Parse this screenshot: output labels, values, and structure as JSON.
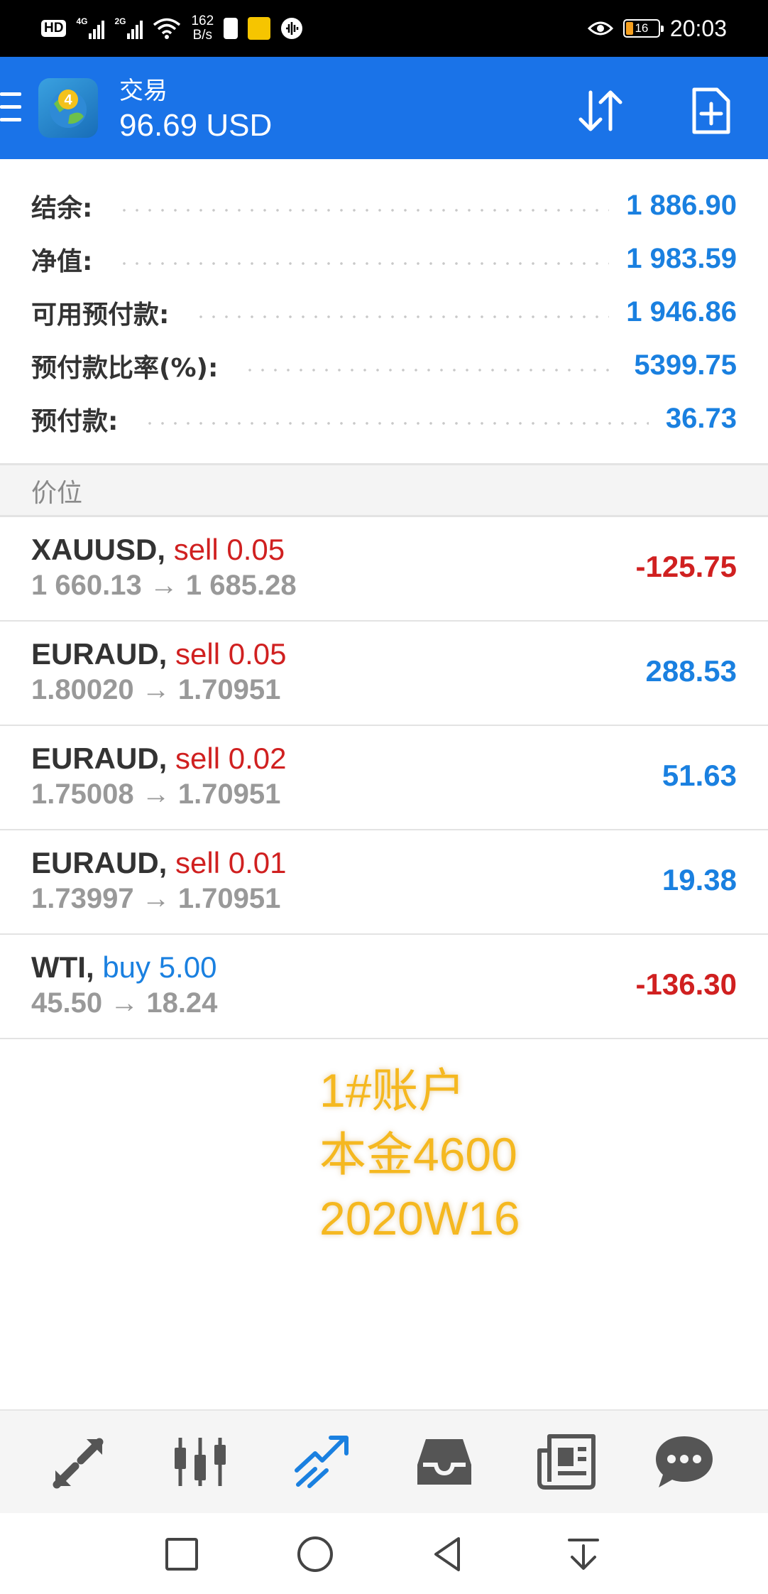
{
  "status_bar": {
    "hd": "HD",
    "net1": "4G",
    "net2": "2G",
    "speed_value": "162",
    "speed_unit": "B/s",
    "battery": "16",
    "time": "20:03"
  },
  "header": {
    "title": "交易",
    "balance": "96.69 USD"
  },
  "summary": [
    {
      "label": "结余:",
      "value": "1 886.90"
    },
    {
      "label": "净值:",
      "value": "1 983.59"
    },
    {
      "label": "可用预付款:",
      "value": "1 946.86"
    },
    {
      "label": "预付款比率(%):",
      "value": "5399.75"
    },
    {
      "label": "预付款:",
      "value": "36.73"
    }
  ],
  "positions_header": "价位",
  "positions": [
    {
      "symbol": "XAUUSD,",
      "side": "sell 0.05",
      "prices": "1 660.13 → 1 685.28",
      "pl": "-125.75"
    },
    {
      "symbol": "EURAUD,",
      "side": "sell 0.05",
      "prices": "1.80020 → 1.70951",
      "pl": "288.53"
    },
    {
      "symbol": "EURAUD,",
      "side": "sell 0.02",
      "prices": "1.75008 → 1.70951",
      "pl": "51.63"
    },
    {
      "symbol": "EURAUD,",
      "side": "sell 0.01",
      "prices": "1.73997 → 1.70951",
      "pl": "19.38"
    },
    {
      "symbol": "WTI,",
      "side": "buy 5.00",
      "prices": "45.50 → 18.24",
      "pl": "-136.30"
    }
  ],
  "note": {
    "line1": "1#账户",
    "line2": "本金4600",
    "line3": "2020W16"
  },
  "colors": {
    "accent": "#1a73e8",
    "positive": "#1a80e0",
    "negative": "#d02020",
    "note": "#f5b820"
  },
  "tabs": [
    "quotes-icon",
    "chart-icon",
    "trade-icon",
    "history-icon",
    "news-icon",
    "chat-icon"
  ],
  "active_tab": "trade-icon"
}
